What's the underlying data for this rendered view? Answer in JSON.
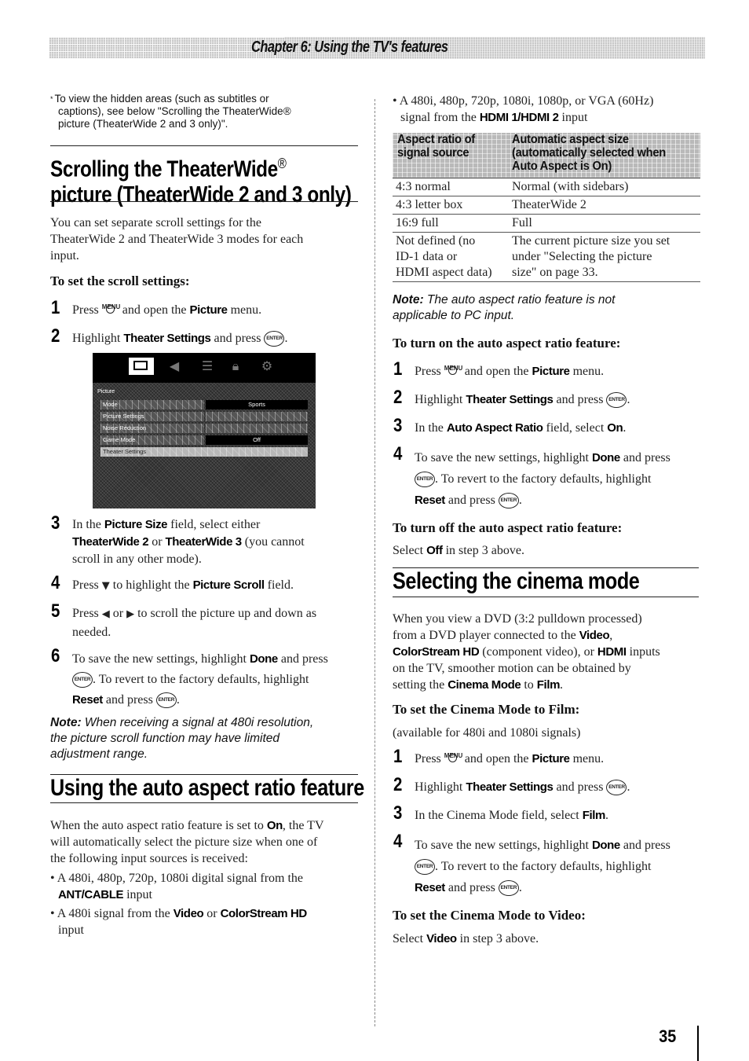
{
  "header": {
    "chapter_title": "Chapter 6: Using the TV's features"
  },
  "footnote": {
    "marker": "*",
    "lines": [
      "To view the hidden areas (such as subtitles or",
      "captions), see below \"Scrolling the TheaterWide®",
      "picture (TheaterWide 2 and 3 only)\"."
    ]
  },
  "scrolling": {
    "title_line1": "Scrolling the TheaterWide",
    "title_reg": "®",
    "title_line2": "picture (TheaterWide 2 and 3 only)",
    "intro": [
      "You can set separate scroll settings for the",
      "TheaterWide 2 and TheaterWide 3 modes for each",
      "input."
    ],
    "subhead": "To set the scroll settings:",
    "steps": [
      {
        "num": "1",
        "a": "Press",
        "key": "MENU",
        "b": "and open the",
        "bold": "Picture",
        "c": "menu."
      },
      {
        "num": "2",
        "a": "Highlight",
        "bold": "Theater Settings",
        "b": "and press",
        "key": "ENTER",
        "c": "."
      },
      {
        "num": "3",
        "a": "In the",
        "bold1": "Picture Size",
        "b": "field, select either",
        "bold2": "TheaterWide 2",
        "c": "or",
        "bold3": "TheaterWide 3",
        "d": "(you cannot",
        "e": "scroll in any other mode)."
      },
      {
        "num": "4",
        "a": "Press",
        "arrow": "▼",
        "b": "to highlight the",
        "bold": "Picture Scroll",
        "c": "field."
      },
      {
        "num": "5",
        "a": "Press",
        "arrow1": "◀",
        "b": "or",
        "arrow2": "▶",
        "c": "to scroll the picture up and down as",
        "d": "needed."
      },
      {
        "num": "6",
        "a": "To save the new settings, highlight",
        "bold1": "Done",
        "b": "and press",
        "key": "ENTER",
        "c": ". To revert to the factory defaults, highlight",
        "bold2": "Reset",
        "d": "and press",
        "e": "."
      }
    ],
    "note_label": "Note:",
    "note_lines": [
      "When receiving a signal at 480i resolution,",
      "the picture scroll function may have limited",
      "adjustment range."
    ]
  },
  "tv_menu": {
    "tabs": [
      "picture-tab",
      "audio-tab",
      "setup-tab",
      "lock-tab",
      "options-tab"
    ],
    "section": "Picture",
    "rows": [
      {
        "name": "Mode",
        "value": "Sports"
      },
      {
        "name": "Picture Settings",
        "value": ""
      },
      {
        "name": "Noise Reduction",
        "value": ""
      },
      {
        "name": "Game Mode",
        "value": "Off"
      },
      {
        "name": "Theater Settings",
        "value": ""
      }
    ]
  },
  "auto_aspect": {
    "title": "Using the auto aspect ratio feature",
    "intro_a": "When the auto aspect ratio feature is set to",
    "intro_bold": "On",
    "intro_b": ", the TV",
    "intro_lines": [
      "will automatically select the picture size when one of",
      "the following input sources is received:"
    ],
    "bullets": [
      {
        "text": "A 480i, 480p, 720p, 1080i digital signal from the",
        "bold": "ANT/CABLE",
        "after": "input"
      },
      {
        "text": "A 480i signal from the",
        "bold1": "Video",
        "mid": "or",
        "bold2": "ColorStream HD",
        "after": "input"
      },
      {
        "text": "A 480i, 480p, 720p, 1080i, 1080p, or VGA (60Hz)",
        "text2": "signal from the",
        "bold": "HDMI 1/HDMI 2",
        "after": "input"
      }
    ],
    "table": {
      "headers": [
        "Aspect ratio of signal source",
        "Automatic aspect size (automatically selected when Auto Aspect is On)"
      ],
      "header_lines": [
        [
          "Aspect ratio of",
          "signal source"
        ],
        [
          "Automatic aspect size",
          "(automatically selected when",
          "Auto Aspect is On)"
        ]
      ],
      "rows": [
        [
          [
            "4:3 normal"
          ],
          [
            "Normal (with sidebars)"
          ]
        ],
        [
          [
            "4:3 letter box"
          ],
          [
            "TheaterWide 2"
          ]
        ],
        [
          [
            "16:9 full"
          ],
          [
            "Full"
          ]
        ],
        [
          [
            "Not defined (no",
            "ID-1 data or",
            "HDMI aspect data)"
          ],
          [
            "The current picture size you set",
            "under \"Selecting the picture",
            "size\" on page 33."
          ]
        ]
      ]
    },
    "note_label": "Note:",
    "note_lines": [
      "The auto aspect ratio feature is not",
      "applicable to PC input."
    ],
    "on_subhead": "To turn on the auto aspect ratio feature:",
    "on_steps": [
      {
        "num": "1",
        "a": "Press",
        "key": "MENU",
        "b": "and open the",
        "bold": "Picture",
        "c": "menu."
      },
      {
        "num": "2",
        "a": "Highlight",
        "bold": "Theater Settings",
        "b": "and press",
        "key": "ENTER",
        "c": "."
      },
      {
        "num": "3",
        "a": "In the",
        "bold1": "Auto Aspect Ratio",
        "b": "field, select",
        "bold2": "On",
        "c": "."
      },
      {
        "num": "4",
        "a": "To save the new settings, highlight",
        "bold1": "Done",
        "b": "and press",
        "key": "ENTER",
        "c": ". To revert to the factory defaults, highlight",
        "bold2": "Reset",
        "d": "and press",
        "e": "."
      }
    ],
    "off_subhead": "To turn off the auto aspect ratio feature:",
    "off_a": "Select",
    "off_bold": "Off",
    "off_b": "in step 3 above."
  },
  "cinema": {
    "title": "Selecting the cinema mode",
    "intro_l1": "When you view a DVD (3:2 pulldown processed)",
    "intro_l2a": "from a DVD player connected to the",
    "intro_l2bold": "Video",
    "intro_l2b": ",",
    "intro_l3bold1": "ColorStream HD",
    "intro_l3a": "(component video), or",
    "intro_l3bold2": "HDMI",
    "intro_l3b": "inputs",
    "intro_l4": "on the TV, smoother motion can be obtained by",
    "intro_l5a": "setting the",
    "intro_l5bold1": "Cinema Mode",
    "intro_l5b": "to",
    "intro_l5bold2": "Film",
    "intro_l5c": ".",
    "film_subhead": "To set the Cinema Mode to Film:",
    "film_avail": "(available for 480i and 1080i signals)",
    "film_steps": [
      {
        "num": "1",
        "a": "Press",
        "key": "MENU",
        "b": "and open the",
        "bold": "Picture",
        "c": "menu."
      },
      {
        "num": "2",
        "a": "Highlight",
        "bold": "Theater Settings",
        "b": "and press",
        "key": "ENTER",
        "c": "."
      },
      {
        "num": "3",
        "a": "In the Cinema Mode field, select",
        "bold": "Film",
        "c": "."
      },
      {
        "num": "4",
        "a": "To save the new settings, highlight",
        "bold1": "Done",
        "b": "and press",
        "key": "ENTER",
        "c": ". To revert to the factory defaults, highlight",
        "bold2": "Reset",
        "d": "and press",
        "e": "."
      }
    ],
    "video_subhead": "To set the Cinema Mode to Video:",
    "video_a": "Select",
    "video_bold": "Video",
    "video_b": "in step 3 above."
  },
  "keys": {
    "menu": "MENU",
    "enter": "ENTER"
  },
  "footer": {
    "page_number": "35"
  }
}
